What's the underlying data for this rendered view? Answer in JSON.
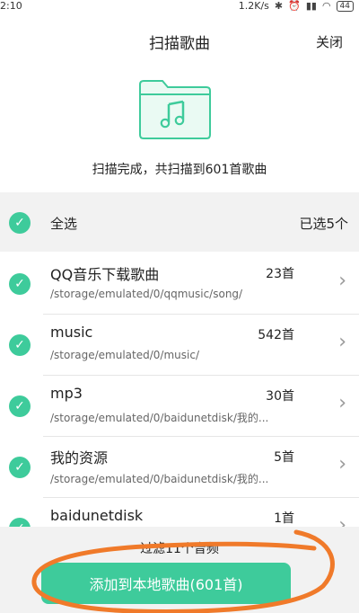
{
  "status_bar": {
    "time": "2:10",
    "speed": "1.2K/s",
    "battery": "44"
  },
  "header": {
    "title": "扫描歌曲",
    "close_label": "关闭"
  },
  "scan_result": "扫描完成，共扫描到601首歌曲",
  "select_all": {
    "label": "全选",
    "selected_count": "已选5个"
  },
  "folders": [
    {
      "name": "QQ音乐下载歌曲",
      "count": "23首",
      "path": "/storage/emulated/0/qqmusic/song/"
    },
    {
      "name": "music",
      "count": "542首",
      "path": "/storage/emulated/0/music/"
    },
    {
      "name": "mp3",
      "count": "30首",
      "path": "/storage/emulated/0/baidunetdisk/我的..."
    },
    {
      "name": "我的资源",
      "count": "5首",
      "path": "/storage/emulated/0/baidunetdisk/我的..."
    },
    {
      "name": "baidunetdisk",
      "count": "1首",
      "path": ""
    }
  ],
  "bottom": {
    "filter_text": "过滤11个音频",
    "add_button_label": "添加到本地歌曲(601首)"
  },
  "colors": {
    "accent": "#3ecb9b",
    "annotation": "#f07a2a"
  },
  "icons": [
    "music-folder-icon",
    "check-icon",
    "chevron-right-icon",
    "bluetooth-icon",
    "alarm-icon",
    "wifi-icon",
    "battery-icon"
  ]
}
